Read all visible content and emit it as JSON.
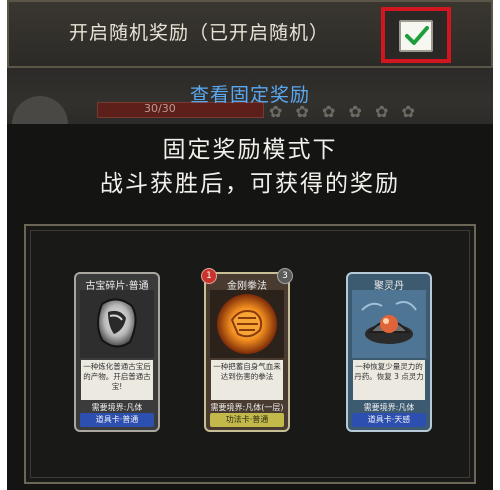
{
  "top": {
    "toggle_label": "开启随机奖励（已开启随机）",
    "toggle_checked": true,
    "view_fixed_link": "查看固定奖励",
    "bg_hp_text": "30/30",
    "highlight_color": "#d11620",
    "link_color": "#5aa8f2"
  },
  "bottom": {
    "title_line1": "固定奖励模式下",
    "title_line2": "战斗获胜后，可获得的奖励",
    "cards": [
      {
        "name": "古宝碎片·普通",
        "icon": "ancient-treasure-fragment-icon",
        "description": "一种炼化普通古宝后的产物。开启普通古宝!",
        "requirement": "需要境界:凡体",
        "type": "道具卡·普通",
        "type_color": "#2d4fb0"
      },
      {
        "name": "金刚拳法",
        "icon": "golden-fist-icon",
        "cost_left": "1",
        "cost_right": "3",
        "stars": "☆☆☆",
        "description": "一种把蓄自身气血来达到伤害的拳法",
        "requirement": "需要境界:凡体(一层)",
        "type": "功法卡·普通",
        "type_color": "#c2b94a"
      },
      {
        "name": "聚灵丹",
        "icon": "spirit-pill-icon",
        "description": "一种恢复少量灵力的丹药。恢复 3 点灵力",
        "requirement": "需要境界:凡体",
        "type": "道具卡·天感",
        "type_color": "#2d4fb0"
      }
    ]
  }
}
